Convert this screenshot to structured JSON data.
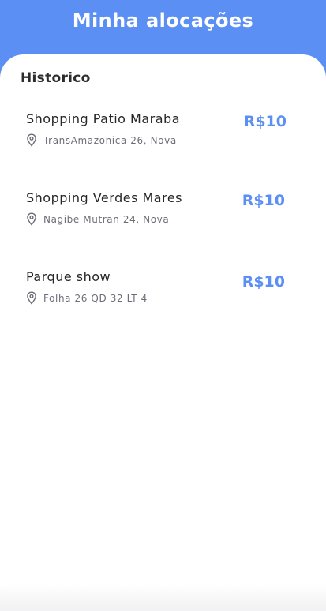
{
  "header": {
    "title": "Minha alocações"
  },
  "history": {
    "title": "Historico",
    "items": [
      {
        "name": "Shopping Patio Maraba",
        "address": "TransAmazonica 26, Nova",
        "price": "R$10"
      },
      {
        "name": "Shopping Verdes Mares",
        "address": "Nagibe Mutran 24, Nova",
        "price": "R$10"
      },
      {
        "name": "Parque show",
        "address": "Folha 26 QD 32 LT 4",
        "price": "R$10"
      }
    ]
  },
  "colors": {
    "accent": "#5b8ff3",
    "text": "#262626",
    "muted": "#6d6d78",
    "background": "#ffffff"
  },
  "icons": {
    "address": "location-pin-icon"
  }
}
